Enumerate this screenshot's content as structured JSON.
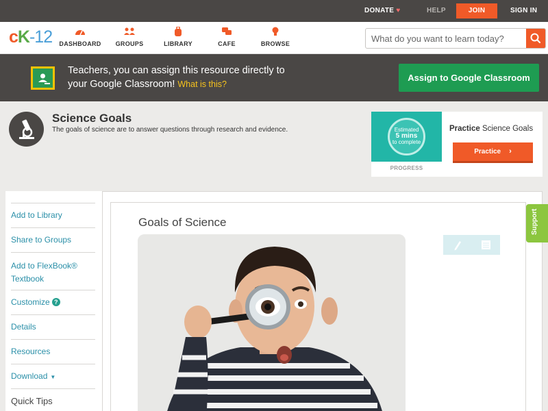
{
  "topbar": {
    "donate": "DONATE",
    "help": "HELP",
    "join": "JOIN",
    "signin": "SIGN IN"
  },
  "logo": {
    "c": "c",
    "k": "K",
    "num": "-12"
  },
  "nav": {
    "items": [
      {
        "label": "DASHBOARD",
        "icon": "dashboard-gauge-icon"
      },
      {
        "label": "GROUPS",
        "icon": "groups-people-icon"
      },
      {
        "label": "LIBRARY",
        "icon": "library-backpack-icon"
      },
      {
        "label": "CAFE",
        "icon": "cafe-chat-icon"
      },
      {
        "label": "BROWSE",
        "icon": "browse-lightbulb-icon"
      }
    ],
    "search_placeholder": "What do you want to learn today?"
  },
  "banner": {
    "text": "Teachers, you can assign this resource directly to your Google Classroom!",
    "what_link": "What is this?",
    "button": "Assign to Google Classroom"
  },
  "concept": {
    "title": "Science Goals",
    "description": "The goals of science are to answer questions through research and evidence."
  },
  "practice_card": {
    "estimated": "Estimated",
    "mins": "5 mins",
    "to_complete": "to complete",
    "progress_label": "PROGRESS",
    "heading_bold": "Practice",
    "heading_rest": " Science Goals",
    "button": "Practice"
  },
  "sidebar": {
    "items": [
      {
        "label": "Add to Library"
      },
      {
        "label": "Share to Groups"
      },
      {
        "label": "Add to FlexBook® Textbook"
      },
      {
        "label": "Customize"
      },
      {
        "label": "Details"
      },
      {
        "label": "Resources"
      },
      {
        "label": "Download"
      },
      {
        "label": "Quick Tips"
      }
    ]
  },
  "article": {
    "title": "Goals of Science"
  },
  "support": "Support",
  "colors": {
    "brand_orange": "#f05a28",
    "dark_bar": "#4a4745",
    "google_green": "#1e9c52",
    "link_teal": "#2a8fa8",
    "support_green": "#8cc63f"
  }
}
